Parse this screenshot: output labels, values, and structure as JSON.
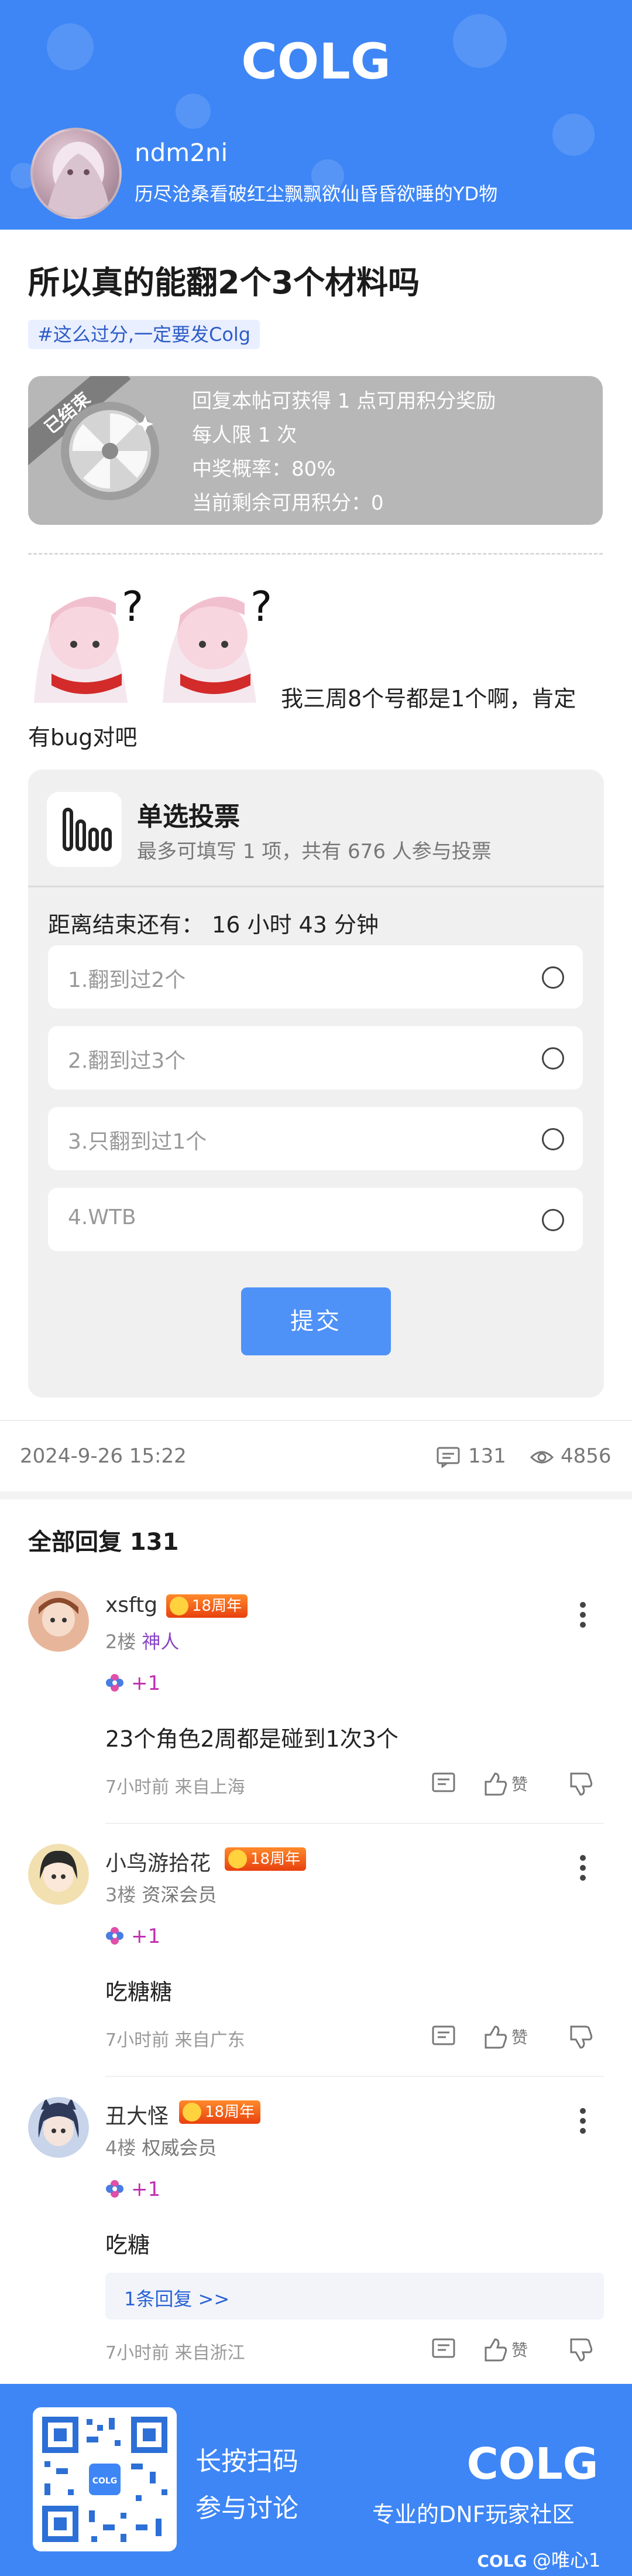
{
  "header": {
    "logo_text": "COLG",
    "username": "ndm2ni",
    "signature": "历尽沧桑看破红尘飘飘欲仙昏昏欲睡的YD物"
  },
  "post": {
    "title": "所以真的能翻2个3个材料吗",
    "tag": "#这么过分,一定要发Colg",
    "content_line1": "我三周8个号都是1个啊，肯定",
    "content_line2": "有bug对吧",
    "date": "2024-9-26 15:22",
    "comments": "131",
    "views": "4856"
  },
  "reward": {
    "ribbon": "已结束",
    "lines": [
      "回复本帖可获得 1 点可用积分奖励",
      "每人限 1 次",
      "中奖概率：80%",
      "当前剩余可用积分：0"
    ]
  },
  "poll": {
    "title": "单选投票",
    "subtitle": "最多可填写 1 项，共有 676 人参与投票",
    "countdown_label": "距离结束还有：",
    "countdown_value": "16 小时 43 分钟",
    "options": [
      {
        "label": "1.翻到过2个"
      },
      {
        "label": "2.翻到过3个"
      },
      {
        "label": "3.只翻到过1个"
      },
      {
        "label": "4.WTB"
      }
    ],
    "submit_label": "提交"
  },
  "replies": {
    "header": "全部回复  131",
    "items": [
      {
        "name": "xsftg",
        "badge": "18周年",
        "floor": "2楼",
        "role": "神人",
        "plus": "+1",
        "text": "23个角色2周都是碰到1次3个",
        "time": "7小时前 来自上海",
        "like_label": "赞"
      },
      {
        "name": "小鸟游拾花",
        "badge": "18周年",
        "floor": "3楼",
        "role": "资深会员",
        "plus": "+1",
        "text": "吃糖糖",
        "time": "7小时前 来自广东",
        "like_label": "赞"
      },
      {
        "name": "丑大怪",
        "badge": "18周年",
        "floor": "4楼",
        "role": "权威会员",
        "plus": "+1",
        "text": "吃糖",
        "sub_reply": "1条回复 >>",
        "time": "7小时前 来自浙江",
        "like_label": "赞"
      }
    ]
  },
  "footer": {
    "line1": "长按扫码",
    "line2": "参与讨论",
    "logo_text": "COLG",
    "tagline": "专业的DNF玩家社区",
    "credit": "@唯心1"
  },
  "colors": {
    "brand_blue": "#3e86f5",
    "submit_blue": "#4e91f7",
    "badge_orange": "#e8410e",
    "link_blue": "#2a62d6"
  }
}
